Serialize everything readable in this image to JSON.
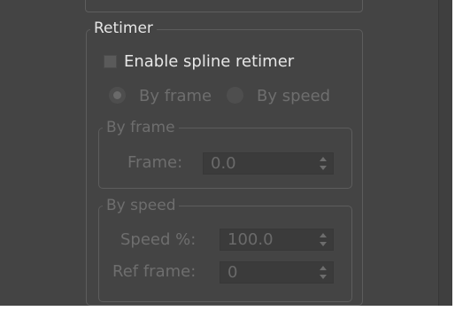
{
  "retimer": {
    "title": "Retimer",
    "enable_label": "Enable spline retimer",
    "radio_by_frame": "By frame",
    "radio_by_speed": "By speed"
  },
  "by_frame_group": {
    "title": "By frame",
    "frame_label": "Frame:",
    "frame_value": "0.0"
  },
  "by_speed_group": {
    "title": "By speed",
    "speed_label": "Speed %:",
    "speed_value": "100.0",
    "ref_frame_label": "Ref frame:",
    "ref_frame_value": "0"
  }
}
